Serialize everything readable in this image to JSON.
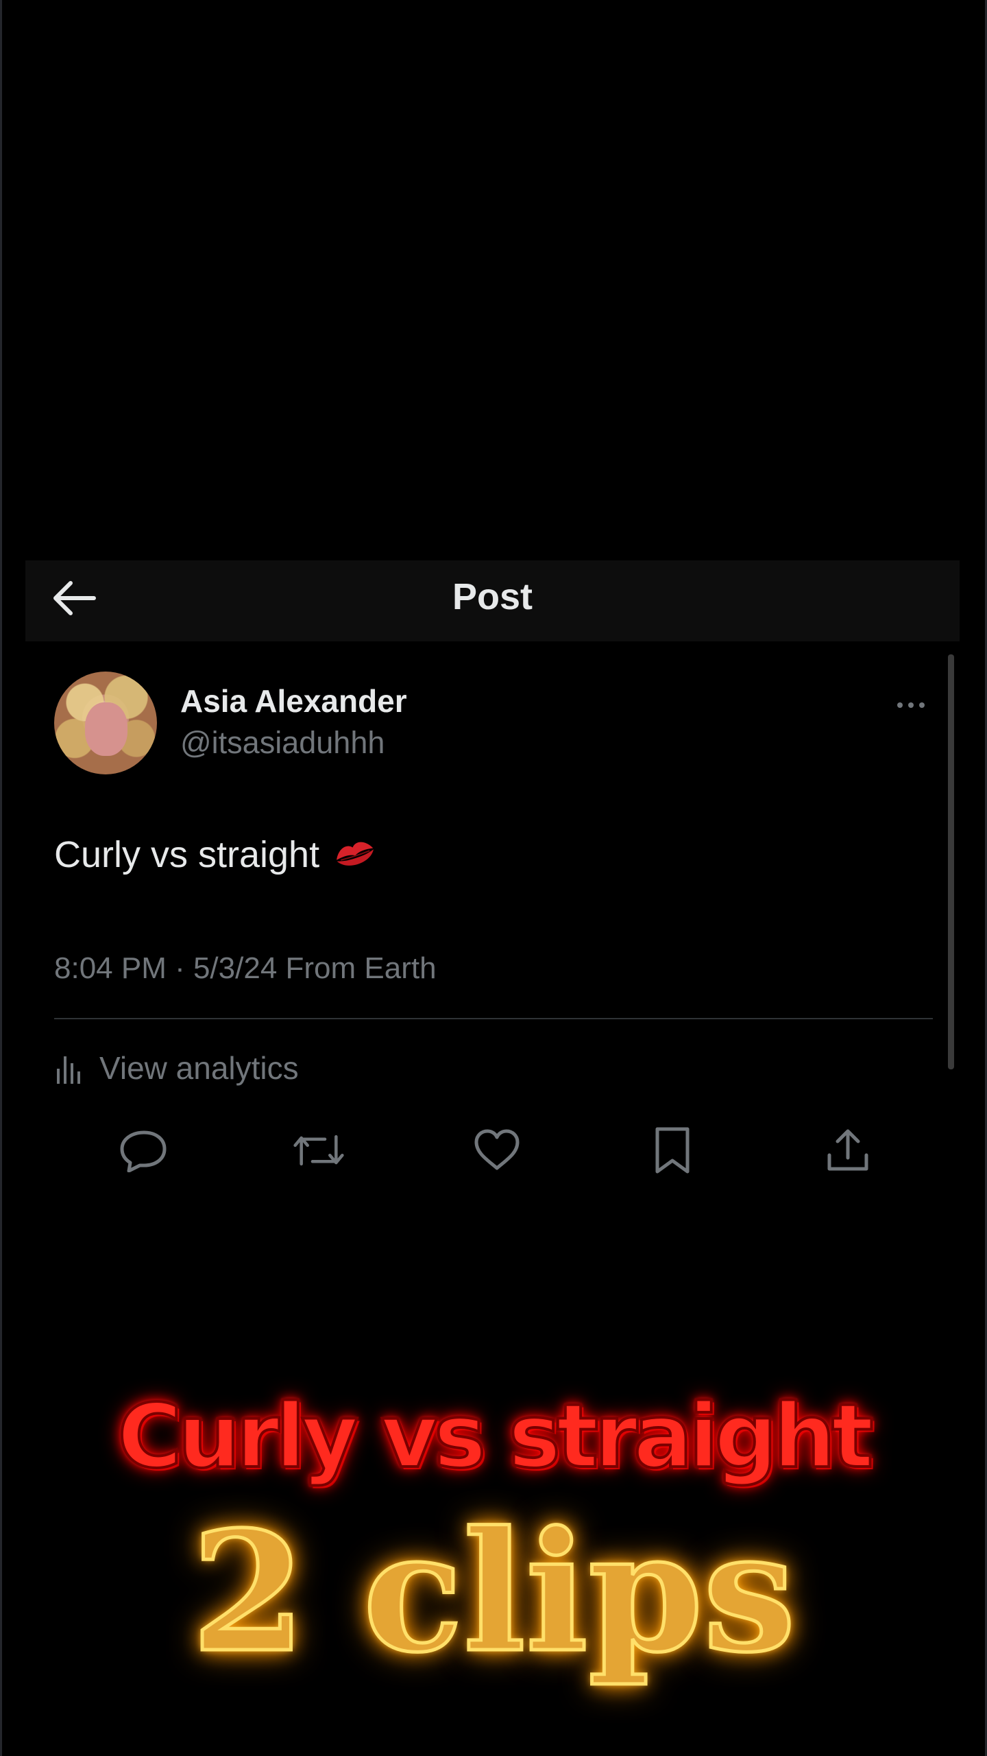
{
  "header": {
    "title": "Post"
  },
  "author": {
    "name": "Asia Alexander",
    "handle": "@itsasiaduhhh"
  },
  "tweet": {
    "text": "Curly vs straight",
    "emoji": "kiss-mark",
    "timestamp": "8:04 PM · 5/3/24 From Earth"
  },
  "analytics": {
    "label": "View analytics"
  },
  "actions": [
    {
      "icon": "reply-icon"
    },
    {
      "icon": "repost-icon"
    },
    {
      "icon": "like-icon"
    },
    {
      "icon": "bookmark-icon"
    },
    {
      "icon": "share-icon"
    }
  ],
  "overlay": {
    "line1": "Curly vs straight",
    "line2": "2 clips"
  },
  "colors": {
    "background": "#000000",
    "text_primary": "#e7e9ea",
    "text_secondary": "#71767b",
    "caption_red": "#ff2a1f",
    "caption_gold": "#e4a534"
  }
}
